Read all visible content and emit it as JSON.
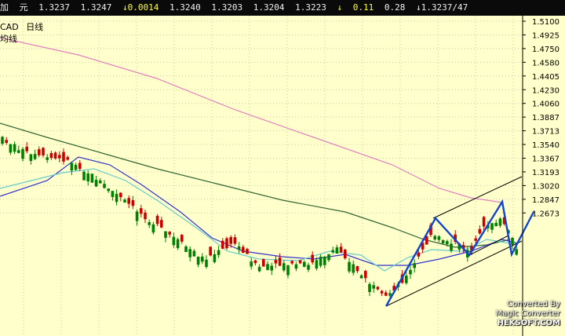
{
  "quote_bar": {
    "cells": [
      "加",
      "元",
      "1.3237",
      "1.3247",
      "↓0.0014",
      "1.3240",
      "1.3203",
      "1.3204",
      "1.3223",
      "↓",
      "0.11",
      "0.28",
      "↓1.3237/47"
    ]
  },
  "chart_header": {
    "symbol": "CAD",
    "period": "日线",
    "indicator": "均线"
  },
  "axis": {
    "ticks": [
      "1.5100",
      "1.4925",
      "1.4750",
      "1.4580",
      "1.4405",
      "1.4230",
      "1.4060",
      "1.3887",
      "1.3713",
      "1.3540",
      "1.3367",
      "1.3193",
      "1.3020",
      "1.2847",
      "1.2673"
    ]
  },
  "watermark": {
    "line1": "Converted By",
    "line2": "Magic Converter",
    "line3": "HEKSOFT.COM"
  },
  "colors": {
    "background": "#ffffcc",
    "grid": "#c8c8a0",
    "up_candle": "#cc0000",
    "down_candle": "#008000",
    "ma_short": "#66cccc",
    "ma_mid": "#3333cc",
    "ma_long": "#336633",
    "ma_longest": "#e080c0",
    "trend_lines": "#000000",
    "zigzag": "#1144cc"
  }
}
